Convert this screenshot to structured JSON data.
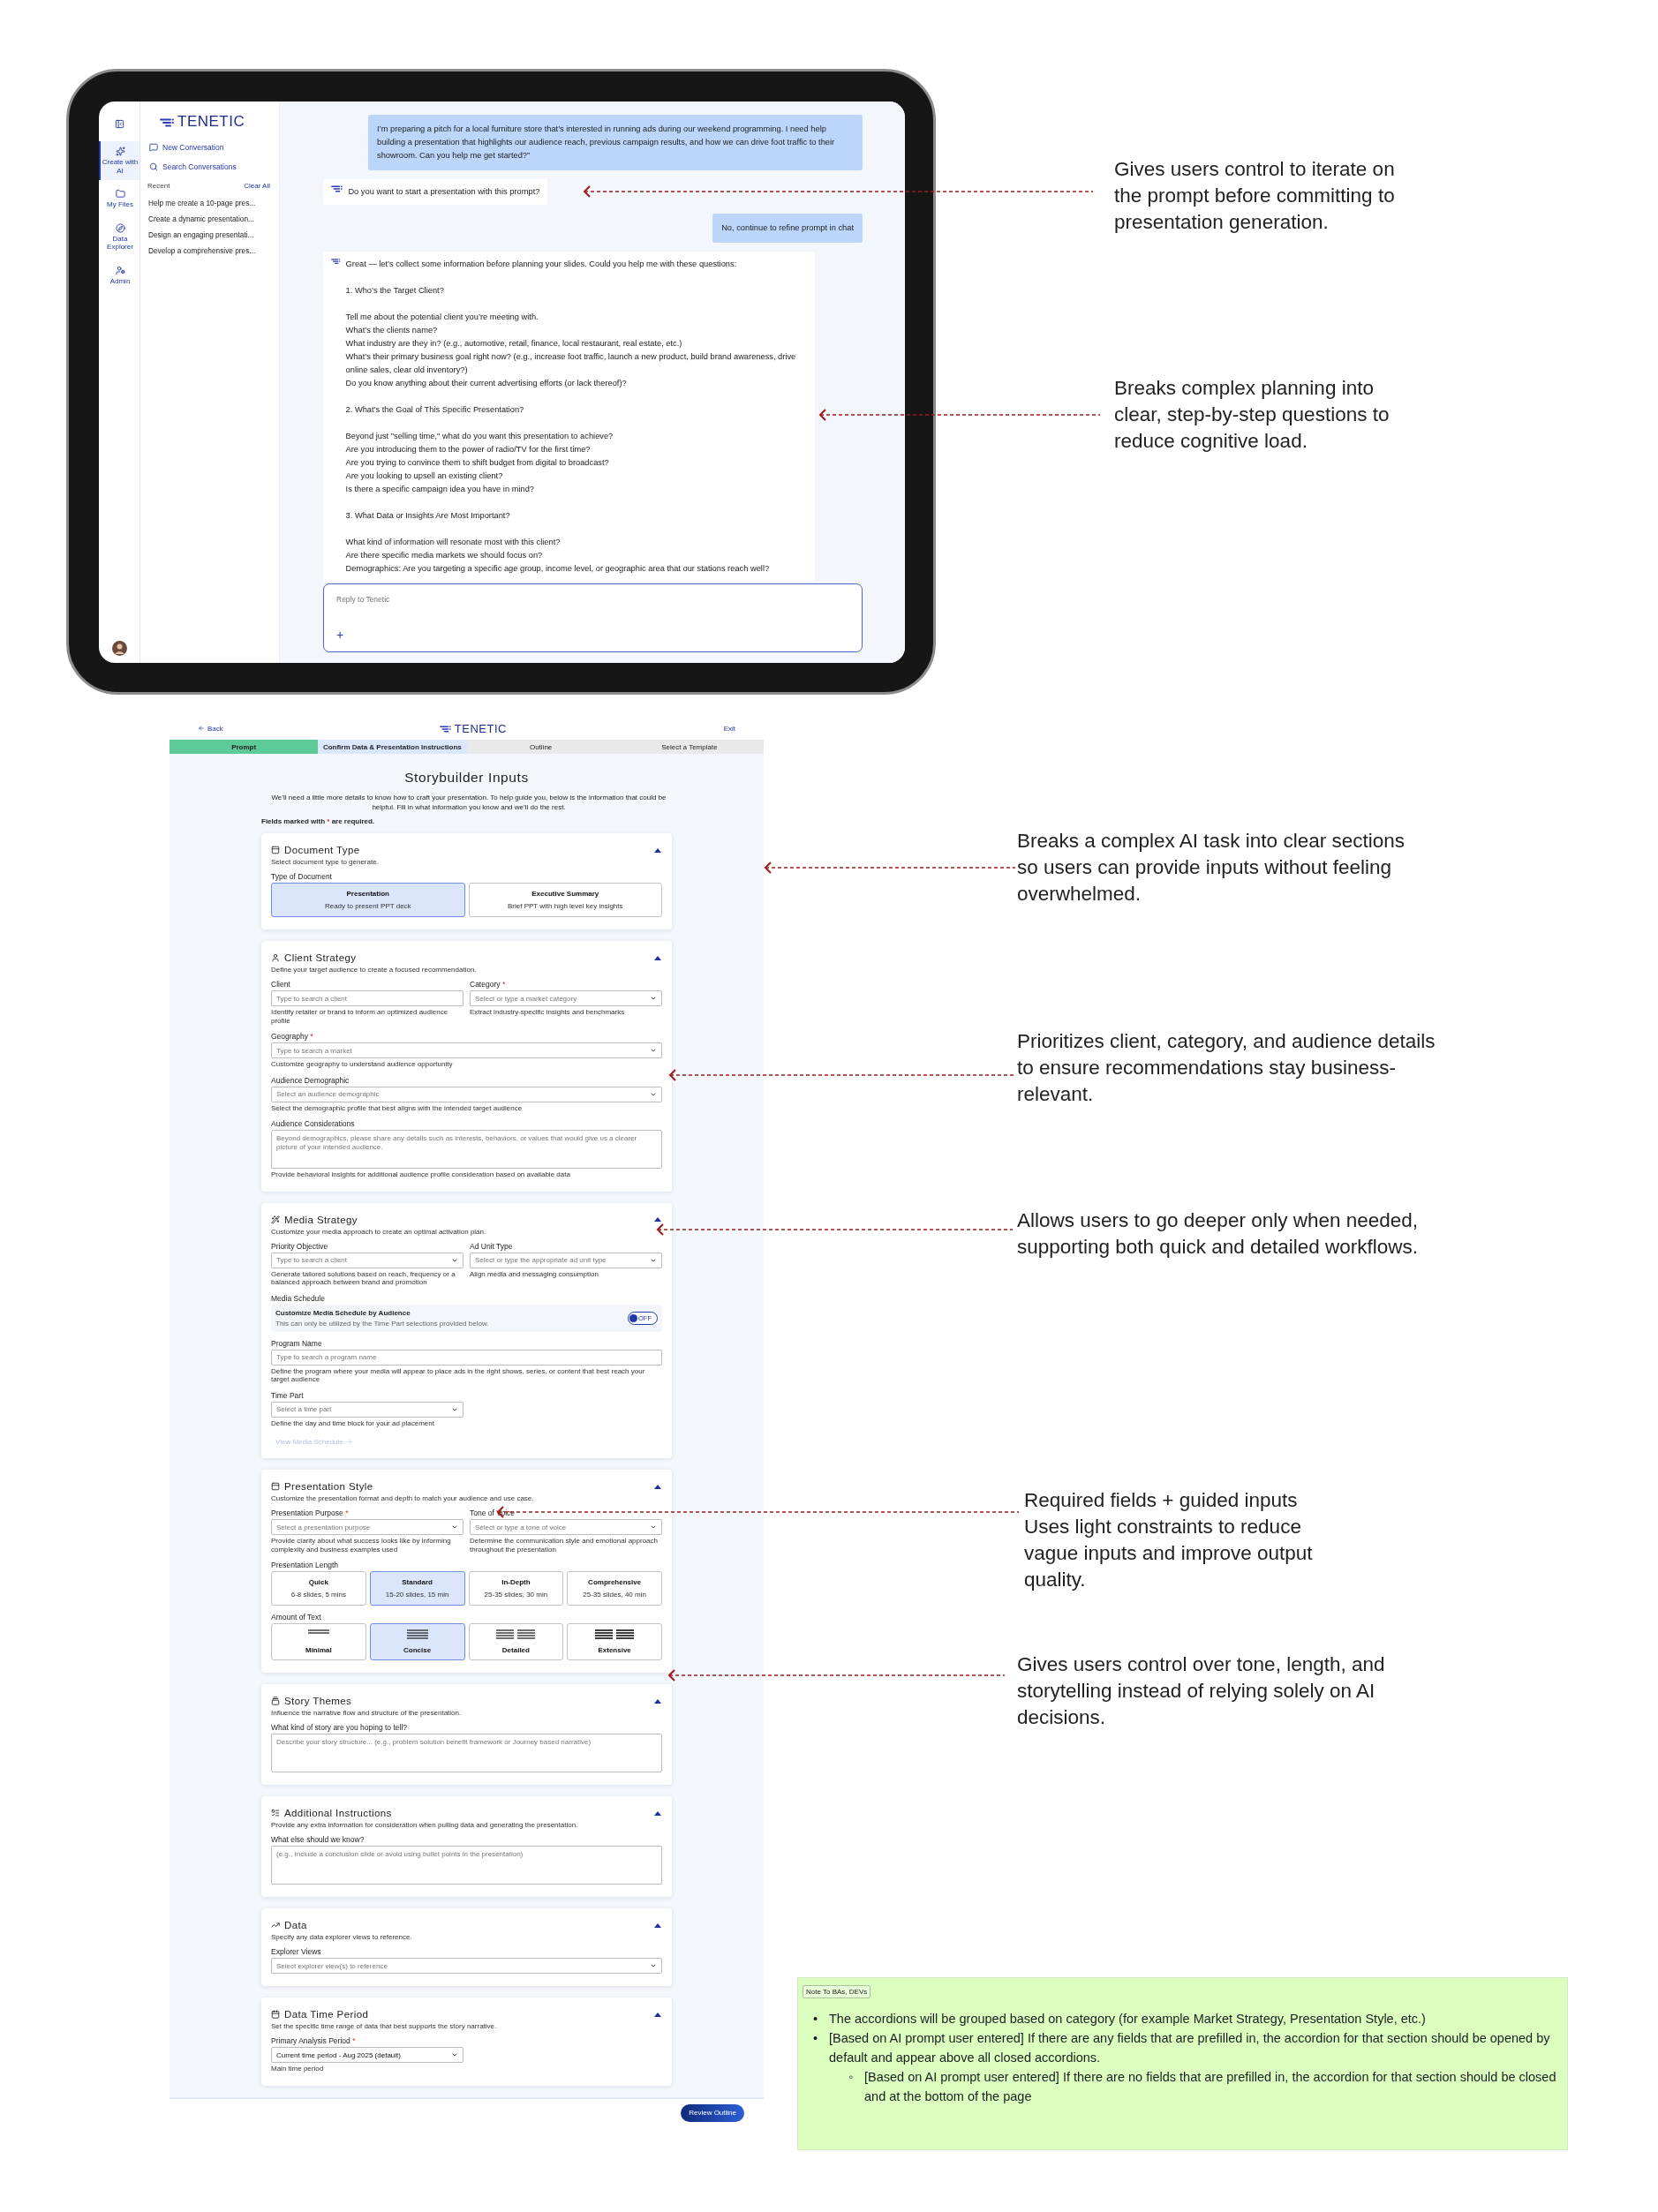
{
  "tablet": {
    "rail": [
      {
        "label": "Create with AI",
        "selected": true
      },
      {
        "label": "My Files",
        "selected": false
      },
      {
        "label": "Data Explorer",
        "selected": false
      },
      {
        "label": "Admin",
        "selected": false
      }
    ],
    "logo": "TENETIC",
    "actions": [
      "New Conversation",
      "Search Conversations"
    ],
    "recent": {
      "title": "Recent",
      "clear": "Clear All",
      "items": [
        "Help me create a 10-page pres...",
        "Create a dynamic presentation...",
        "Design an engaging presentati...",
        "Develop a comprehensive pres..."
      ]
    },
    "messages": [
      {
        "kind": "user",
        "blocks": [
          [
            "I’m preparing a pitch for a local furniture store that’s interested in running ads during our weekend programming. I need help building a presentation that highlights our audience reach, previous campaign results, and how we can drive foot traffic to their showroom. Can you help me get started?”"
          ]
        ]
      },
      {
        "kind": "bot",
        "blocks": [
          [
            "Do you want to start a presentation with this prompt?"
          ]
        ]
      },
      {
        "kind": "user",
        "blocks": [
          [
            "No, continue to refine prompt in chat"
          ]
        ]
      },
      {
        "kind": "bot",
        "blocks": [
          [
            "Great — let’s collect some information before planning your slides. Could you help me with these questions:"
          ],
          [
            "1. Who’s the Target Client?"
          ],
          [
            "Tell me about the potential client you’re meeting with.",
            "What’s the clients name?",
            "What industry are they in? (e.g., automotive, retail, finance, local restaurant, real estate, etc.)",
            "What’s their primary business goal right now? (e.g., increase foot traffic, launch a new product, build brand awareness, drive online sales, clear old inventory?)",
            "Do you know anything about their current advertising efforts (or lack thereof)?"
          ],
          [
            "2. What’s the Goal of This Specific Presentation?"
          ],
          [
            "Beyond just \"selling time,\" what do you want this presentation to achieve?",
            "Are you introducing them to the power of radio/TV for the first time?",
            "Are you trying to convince them to shift budget from digital to broadcast?",
            "Are you looking to upsell an existing client?",
            "Is there a specific campaign idea you have in mind?"
          ],
          [
            "3. What Data or Insights Are Most Important?"
          ],
          [
            "What kind of information will resonate most with this client?",
            "Are there specific media markets we should focus on?",
            "Demographics: Are you targeting a specific age group, income level, or geographic area that our stations reach well?"
          ]
        ]
      }
    ],
    "reply": {
      "placeholder": "Reply to Tenetic",
      "add": "+"
    }
  },
  "form": {
    "back": "Back",
    "logo": "TENETIC",
    "exit": "Exit",
    "steps": [
      {
        "label": "Prompt",
        "completed": true,
        "selected": false
      },
      {
        "label": "Confirm Data & Presentation Instructions",
        "completed": false,
        "selected": true
      },
      {
        "label": "Outline",
        "completed": false,
        "selected": false
      },
      {
        "label": "Select a Template",
        "completed": false,
        "selected": false
      }
    ],
    "title": "Storybuilder Inputs",
    "intro": "We’ll need a little more details to know how to craft your presentation. To help guide you, below is the information that could be helpful. Fill in what information you know and we’ll do the rest.",
    "required_note": {
      "before": "Fields marked with",
      "mark": "*",
      "after": "are required."
    },
    "sections": [
      {
        "title": "Document Type",
        "description": "Select document type to generate.",
        "expanded": true,
        "fields": [
          {
            "kind": "cards",
            "label": "Type of Document",
            "options": [
              {
                "title": "Presentation",
                "subtitle": "Ready to present PPT deck",
                "selected": true
              },
              {
                "title": "Executive Summary",
                "subtitle": "Brief PPT with high level key insights",
                "selected": false
              }
            ]
          }
        ]
      },
      {
        "title": "Client Strategy",
        "description": "Define your target audience to create a focused recommendation.",
        "expanded": true,
        "fields": [
          {
            "kind": "input",
            "label": "Client",
            "wide": false,
            "placeholder": "Type to search a client",
            "hint": "Identify retailer or brand to inform an optimized audience profile"
          },
          {
            "kind": "select",
            "label": "Category",
            "required": "*",
            "wide": false,
            "placeholder": "Select or type a market category",
            "hint": "Extract industry-specific insights and benchmarks"
          },
          {
            "kind": "select",
            "label": "Geography",
            "required": "*",
            "wide": true,
            "placeholder": "Type to search a market",
            "hint": "Customize geography to understand audience opportunity"
          },
          {
            "kind": "select",
            "label": "Audience Demographic",
            "wide": true,
            "placeholder": "Select an audience demographic",
            "hint": "Select the demographic profile that best aligns with the intended target audience"
          },
          {
            "kind": "textarea",
            "label": "Audience Considerations",
            "placeholder": "Beyond demographics, please share any details such as interests, behaviors, or values that would give us a clearer picture of your intended audience.",
            "hint": "Provide behavioral insights for additional audience profile consideration based on available data"
          }
        ]
      },
      {
        "title": "Media Strategy",
        "description": "Customize your media approach to create an optimal activation plan.",
        "expanded": true,
        "fields": [
          {
            "kind": "select",
            "label": "Priority Objective",
            "wide": false,
            "placeholder": "Type to search a client",
            "hint": "Generate tailored solutions based on reach, frequency or a balanced approach between brand and promotion"
          },
          {
            "kind": "select",
            "label": "Ad Unit Type",
            "wide": false,
            "placeholder": "Select or type the appropriate ad unit type",
            "hint": "Align media and messaging consumption"
          },
          {
            "kind": "toggle",
            "label": "Media Schedule",
            "title": "Customize Media Schedule by Audience",
            "note": "This can only be utilized by the Time Part selections provided below.",
            "on": false,
            "state_label": "OFF"
          },
          {
            "kind": "input",
            "label": "Program Name",
            "wide": true,
            "placeholder": "Type to search a program name",
            "hint": "Define the program where your media will appear to place ads in the right shows, series, or content that best reach your target audience"
          },
          {
            "kind": "select",
            "label": "Time Part",
            "wide": false,
            "placeholder": "Select a time part",
            "hint": "Define the day and time block for your ad placement"
          },
          {
            "kind": "link",
            "label": "View Media Schedule",
            "disabled": true
          }
        ]
      },
      {
        "title": "Presentation Style",
        "description": "Customize the presentation format and depth to match your audience and use case.",
        "expanded": true,
        "fields": [
          {
            "kind": "select",
            "label": "Presentation Purpose",
            "required": "*",
            "wide": false,
            "placeholder": "Select a presentation purpose",
            "hint": "Provide clarity about what success looks like by informing complexity and business examples used"
          },
          {
            "kind": "select",
            "label": "Tone of Voice",
            "wide": false,
            "placeholder": "Select or type a tone of voice",
            "hint": "Determine the communication style and emotional approach throughout the presentation"
          },
          {
            "kind": "cards",
            "label": "Presentation Length",
            "options": [
              {
                "title": "Quick",
                "subtitle": "6-8 slides, 5 mins",
                "selected": false
              },
              {
                "title": "Standard",
                "subtitle": "15-20 slides, 15 min",
                "selected": true
              },
              {
                "title": "In-Depth",
                "subtitle": "25-35 slides, 30 min",
                "selected": false
              },
              {
                "title": "Comprehensive",
                "subtitle": "25-35 slides, 40 min",
                "selected": false
              }
            ]
          },
          {
            "kind": "amount",
            "label": "Amount of Text",
            "options": [
              {
                "title": "Minimal",
                "selected": false
              },
              {
                "title": "Concise",
                "selected": true
              },
              {
                "title": "Detailed",
                "selected": false
              },
              {
                "title": "Extensive",
                "selected": false
              }
            ]
          }
        ]
      },
      {
        "title": "Story Themes",
        "description": "Influence the narrative flow and structure of the presentation.",
        "expanded": true,
        "fields": [
          {
            "kind": "textarea",
            "label": "What kind of story are you hoping to tell?",
            "placeholder": "Describe your story structure... (e.g., problem solution benefit framework or Journey based narrative)"
          }
        ]
      },
      {
        "title": "Additional Instructions",
        "description": "Provide any extra information for consideration when pulling data and generating the presentation.",
        "expanded": true,
        "fields": [
          {
            "kind": "textarea",
            "label": "What else should we know?",
            "placeholder": "(e.g., Include a conclusion slide or avoid using bullet points in the presentation)"
          }
        ]
      },
      {
        "title": "Data",
        "description": "Specify any data explorer views to reference.",
        "expanded": true,
        "fields": [
          {
            "kind": "select",
            "label": "Explorer Views",
            "wide": true,
            "placeholder": "Select explorer view(s) to reference"
          }
        ]
      },
      {
        "title": "Data Time Period",
        "description": "Set the specific time range of data that best supports the story narrative.",
        "expanded": true,
        "fields": [
          {
            "kind": "select",
            "label": "Primary Analysis Period",
            "required": "*",
            "wide": false,
            "value": "Current time period - Aug 2025 (default)",
            "hint": "Main time period"
          }
        ]
      }
    ],
    "primary_button": "Review Outline"
  },
  "annotations": [
    "Gives users control to iterate on the prompt before committing to presentation generation.",
    "Breaks complex planning into clear, step-by-step questions to reduce cognitive load.",
    "Breaks a complex AI task into clear sections so users can provide inputs without feeling overwhelmed.",
    "Prioritizes client, category, and audience details to ensure recommendations stay business-relevant.",
    "Allows users to go deeper only when needed, supporting both quick and detailed workflows.",
    "Required fields + guided inputs Uses light constraints to reduce vague inputs and improve output quality.",
    "Gives users control over tone, length, and storytelling instead of relying solely on AI decisions."
  ],
  "note": {
    "tag": "Note To BAs, DEVs",
    "items": [
      {
        "marker": "•",
        "text": "The accordions will be grouped based on category (for example Market Strategy, Presentation Style, etc.)"
      },
      {
        "marker": "•",
        "text": "[Based on AI prompt user entered] If there are any fields that are prefilled in, the accordion for that section should be opened by default and appear above all closed accordions.",
        "children": [
          {
            "marker": "◦",
            "text": "[Based on AI prompt user entered] If there are no fields that are prefilled in, the accordion for that section should be closed and at the bottom of the page"
          }
        ]
      }
    ]
  }
}
